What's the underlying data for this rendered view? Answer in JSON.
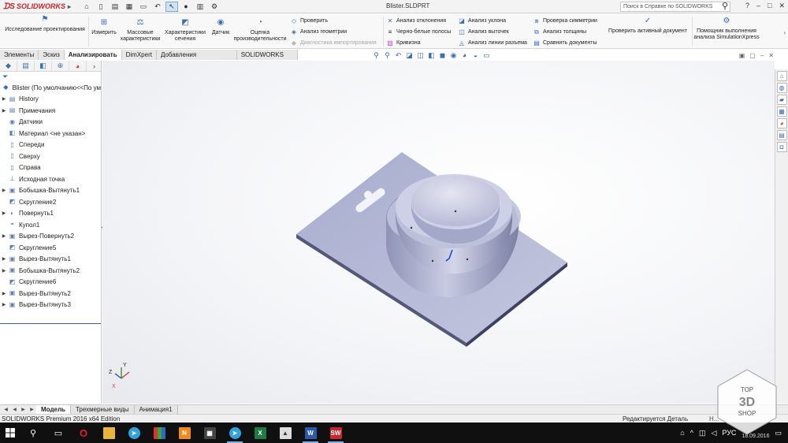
{
  "app": {
    "logo": "SOLIDWORKS",
    "doc_title": "Blister.SLDPRT",
    "search_placeholder": "Поиск в Справке по SOLIDWORKS",
    "window_controls": [
      "?",
      "–",
      "□",
      "✕"
    ]
  },
  "ribbon": {
    "large_buttons": [
      {
        "label": "Исследование проектирования",
        "icon": "design-study-icon"
      },
      {
        "label": "Измерить",
        "icon": "measure-icon"
      },
      {
        "label": "Массовые характеристики",
        "icon": "mass-properties-icon"
      },
      {
        "label": "Характеристики сечения",
        "icon": "section-properties-icon"
      },
      {
        "label": "Датчик",
        "icon": "sensor-icon"
      },
      {
        "label": "Оценка производительности",
        "icon": "performance-icon"
      }
    ],
    "col1": [
      {
        "label": "Проверить",
        "dim": false
      },
      {
        "label": "Анализ геометрии",
        "dim": false
      },
      {
        "label": "Диагностика импортирования",
        "dim": true
      }
    ],
    "col2": [
      {
        "label": "Анализ отклонения"
      },
      {
        "label": "Черно-белые полосы"
      },
      {
        "label": "Кривизна"
      }
    ],
    "col3": [
      {
        "label": "Анализ уклона"
      },
      {
        "label": "Анализ выточек"
      },
      {
        "label": "Анализ линии разъема"
      }
    ],
    "col4": [
      {
        "label": "Проверка симметрии"
      },
      {
        "label": "Анализ толщины"
      },
      {
        "label": "Сравнить документы"
      }
    ],
    "check_active_doc": "Проверить активный документ",
    "simxpress": "Помощник выполнения анализа SimulationXpress"
  },
  "tabs": [
    {
      "label": "Элементы",
      "active": false
    },
    {
      "label": "Эскиз",
      "active": false
    },
    {
      "label": "Анализировать",
      "active": true
    },
    {
      "label": "DimXpert",
      "active": false
    },
    {
      "label": "Добавления SOLIDWORKS",
      "active": false
    },
    {
      "label": "SOLIDWORKS MBD",
      "active": false
    }
  ],
  "tree": {
    "root": "Blister  (По умолчанию<<По ум",
    "items": [
      {
        "label": "History",
        "exp": true
      },
      {
        "label": "Примечания",
        "exp": true
      },
      {
        "label": "Датчики",
        "exp": false
      },
      {
        "label": "Материал <не указан>",
        "exp": false
      },
      {
        "label": "Спереди",
        "exp": false
      },
      {
        "label": "Сверху",
        "exp": false
      },
      {
        "label": "Справа",
        "exp": false
      },
      {
        "label": "Исходная точка",
        "exp": false
      },
      {
        "label": "Бобышка-Вытянуть1",
        "exp": true
      },
      {
        "label": "Скругление2",
        "exp": false
      },
      {
        "label": "Повернуть1",
        "exp": true
      },
      {
        "label": "Купол1",
        "exp": false
      },
      {
        "label": "Вырез-Повернуть2",
        "exp": true
      },
      {
        "label": "Скругление5",
        "exp": false
      },
      {
        "label": "Вырез-Вытянуть1",
        "exp": true
      },
      {
        "label": "Бобышка-Вытянуть2",
        "exp": true
      },
      {
        "label": "Скругление6",
        "exp": false
      },
      {
        "label": "Вырез-Вытянуть2",
        "exp": true
      },
      {
        "label": "Вырез-Вытянуть3",
        "exp": true
      }
    ]
  },
  "bottom_tabs": [
    {
      "label": "Модель",
      "active": true
    },
    {
      "label": "Трехмерные виды",
      "active": false
    },
    {
      "label": "Анимация1",
      "active": false
    }
  ],
  "status": {
    "edition": "SOLIDWORKS Premium 2016 x64 Edition",
    "editing": "Редактируется Деталь",
    "right": "Н..."
  },
  "triad": {
    "x": "X",
    "y": "Y",
    "z": "Z"
  },
  "taskbar": {
    "lang": "РУС",
    "date": "18.09.2016"
  },
  "watermark": {
    "top": "TOP",
    "mid": "3D",
    "bottom": "SHOP"
  },
  "colors": {
    "model": "#b9bcd6",
    "model_dark": "#7e82a6",
    "accent": "#3a6fb0",
    "brand": "#d52027"
  }
}
